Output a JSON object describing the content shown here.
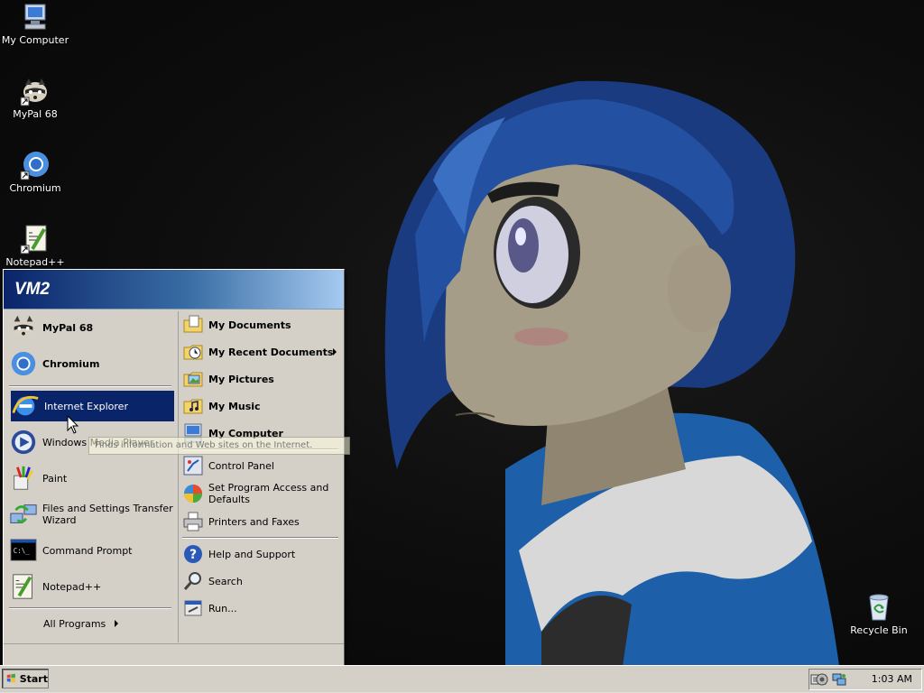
{
  "desktop": {
    "icons": [
      {
        "label": "My Computer",
        "icon": "my-computer-icon"
      },
      {
        "label": "MyPal 68",
        "icon": "raccoon-icon"
      },
      {
        "label": "Chromium",
        "icon": "chromium-icon"
      },
      {
        "label": "Notepad++",
        "icon": "notepad-plus-plus-icon"
      },
      {
        "label": "Recycle Bin",
        "icon": "recycle-bin-icon"
      }
    ]
  },
  "start_menu": {
    "user": "VM2",
    "left": {
      "pinned": [
        {
          "label": "MyPal 68",
          "icon": "raccoon-icon"
        },
        {
          "label": "Chromium",
          "icon": "chromium-icon"
        }
      ],
      "recent": [
        {
          "label": "Internet Explorer",
          "icon": "internet-explorer-icon",
          "highlighted": true
        },
        {
          "label": "Windows Media Player",
          "icon": "media-player-icon"
        },
        {
          "label": "Paint",
          "icon": "paint-icon"
        },
        {
          "label": "Files and Settings Transfer Wizard",
          "icon": "transfer-wizard-icon"
        },
        {
          "label": "Command Prompt",
          "icon": "command-prompt-icon"
        },
        {
          "label": "Notepad++",
          "icon": "notepad-plus-plus-icon"
        }
      ],
      "all_programs": "All Programs"
    },
    "right": {
      "places": [
        {
          "label": "My Documents",
          "icon": "folder-documents-icon"
        },
        {
          "label": "My Recent Documents",
          "icon": "recent-documents-icon",
          "submenu": true
        },
        {
          "label": "My Pictures",
          "icon": "folder-pictures-icon"
        },
        {
          "label": "My Music",
          "icon": "folder-music-icon"
        },
        {
          "label": "My Computer",
          "icon": "my-computer-icon"
        }
      ],
      "settings": [
        {
          "label": "Control Panel",
          "icon": "control-panel-icon"
        },
        {
          "label": "Set Program Access and Defaults",
          "icon": "program-access-icon"
        },
        {
          "label": "Printers and Faxes",
          "icon": "printer-icon"
        }
      ],
      "help": [
        {
          "label": "Help and Support",
          "icon": "help-icon"
        },
        {
          "label": "Search",
          "icon": "search-icon"
        },
        {
          "label": "Run...",
          "icon": "run-icon"
        }
      ]
    },
    "tooltip": "Finds information and Web sites on the Internet."
  },
  "taskbar": {
    "start_label": "Start",
    "clock": "1:03 AM"
  },
  "colors": {
    "menu_header_start": "#0a246a",
    "menu_header_end": "#a6caf0",
    "highlight": "#0a246a",
    "chrome": "#d4d0c8"
  }
}
